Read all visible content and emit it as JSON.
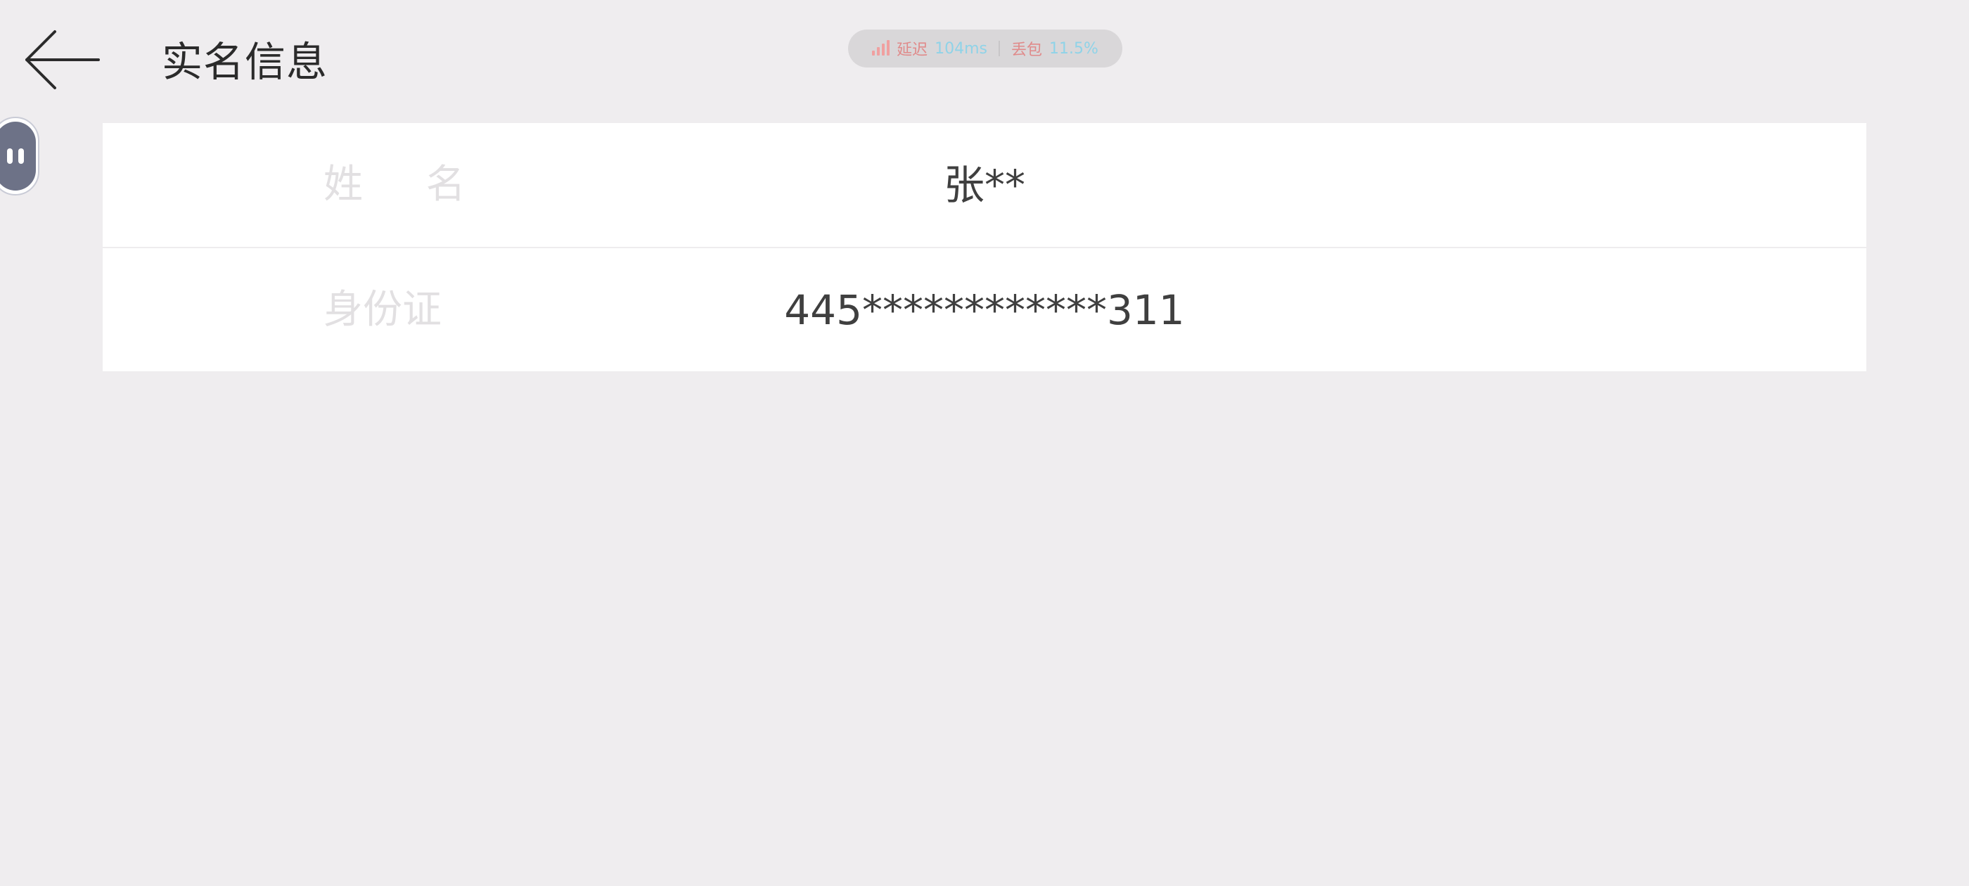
{
  "header": {
    "title": "实名信息",
    "back_icon": "arrow-left-icon"
  },
  "network_status": {
    "latency_label": "延迟",
    "latency_value": "104ms",
    "loss_label": "丢包",
    "loss_value": "11.5%",
    "signal_icon": "signal-bars-icon",
    "colors": {
      "label": "#e08a8a",
      "value": "#8fd3e8"
    }
  },
  "float_button": {
    "icon": "pause-icon"
  },
  "info": {
    "rows": [
      {
        "label": "姓 名",
        "value": "张**"
      },
      {
        "label": "身份证",
        "value": "445************311"
      }
    ]
  }
}
